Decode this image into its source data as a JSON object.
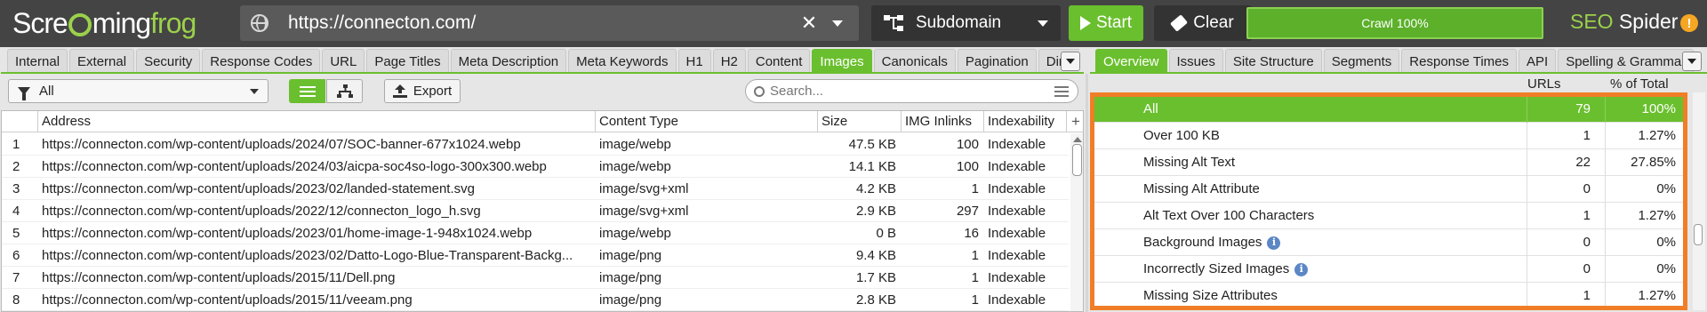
{
  "app": {
    "logo": {
      "part1": "Scre",
      "part2": "ming",
      "part3": "frog"
    },
    "url": "https://connecton.com/",
    "mode": "Subdomain",
    "start_label": "Start",
    "clear_label": "Clear",
    "progress_label": "Crawl 100%",
    "progress_fraction": 1.0,
    "brand_seo": "SEO",
    "brand_spider": "Spider",
    "update_badge": "!"
  },
  "left_tabs": [
    {
      "label": "Internal",
      "active": false
    },
    {
      "label": "External",
      "active": false
    },
    {
      "label": "Security",
      "active": false
    },
    {
      "label": "Response Codes",
      "active": false
    },
    {
      "label": "URL",
      "active": false
    },
    {
      "label": "Page Titles",
      "active": false
    },
    {
      "label": "Meta Description",
      "active": false
    },
    {
      "label": "Meta Keywords",
      "active": false
    },
    {
      "label": "H1",
      "active": false
    },
    {
      "label": "H2",
      "active": false
    },
    {
      "label": "Content",
      "active": false
    },
    {
      "label": "Images",
      "active": true
    },
    {
      "label": "Canonicals",
      "active": false
    },
    {
      "label": "Pagination",
      "active": false
    },
    {
      "label": "Directive",
      "active": false
    }
  ],
  "right_tabs": [
    {
      "label": "Overview",
      "active": true
    },
    {
      "label": "Issues",
      "active": false
    },
    {
      "label": "Site Structure",
      "active": false
    },
    {
      "label": "Segments",
      "active": false
    },
    {
      "label": "Response Times",
      "active": false
    },
    {
      "label": "API",
      "active": false
    },
    {
      "label": "Spelling & Grammar",
      "active": false
    }
  ],
  "toolbar": {
    "filter_value": "All",
    "export_label": "Export",
    "search_placeholder": "Search..."
  },
  "table": {
    "columns": [
      "Address",
      "Content Type",
      "Size",
      "IMG Inlinks",
      "Indexability"
    ],
    "rows": [
      {
        "n": "1",
        "address": "https://connecton.com/wp-content/uploads/2024/07/SOC-banner-677x1024.webp",
        "type": "image/webp",
        "size": "47.5 KB",
        "inlinks": "100",
        "index": "Indexable"
      },
      {
        "n": "2",
        "address": "https://connecton.com/wp-content/uploads/2024/03/aicpa-soc4so-logo-300x300.webp",
        "type": "image/webp",
        "size": "14.1 KB",
        "inlinks": "100",
        "index": "Indexable"
      },
      {
        "n": "3",
        "address": "https://connecton.com/wp-content/uploads/2023/02/landed-statement.svg",
        "type": "image/svg+xml",
        "size": "4.2 KB",
        "inlinks": "1",
        "index": "Indexable"
      },
      {
        "n": "4",
        "address": "https://connecton.com/wp-content/uploads/2022/12/connecton_logo_h.svg",
        "type": "image/svg+xml",
        "size": "2.9 KB",
        "inlinks": "297",
        "index": "Indexable"
      },
      {
        "n": "5",
        "address": "https://connecton.com/wp-content/uploads/2023/01/home-image-1-948x1024.webp",
        "type": "image/webp",
        "size": "0 B",
        "inlinks": "16",
        "index": "Indexable"
      },
      {
        "n": "6",
        "address": "https://connecton.com/wp-content/uploads/2023/02/Datto-Logo-Blue-Transparent-Backg...",
        "type": "image/png",
        "size": "9.4 KB",
        "inlinks": "1",
        "index": "Indexable"
      },
      {
        "n": "7",
        "address": "https://connecton.com/wp-content/uploads/2015/11/Dell.png",
        "type": "image/png",
        "size": "1.7 KB",
        "inlinks": "1",
        "index": "Indexable"
      },
      {
        "n": "8",
        "address": "https://connecton.com/wp-content/uploads/2015/11/veeam.png",
        "type": "image/png",
        "size": "2.8 KB",
        "inlinks": "1",
        "index": "Indexable"
      }
    ]
  },
  "overview": {
    "col_urls": "URLs",
    "col_pct": "% of Total",
    "rows": [
      {
        "label": "All",
        "urls": "79",
        "pct": "100%",
        "active": true,
        "info": false
      },
      {
        "label": "Over 100 KB",
        "urls": "1",
        "pct": "1.27%",
        "active": false,
        "info": false
      },
      {
        "label": "Missing Alt Text",
        "urls": "22",
        "pct": "27.85%",
        "active": false,
        "info": false
      },
      {
        "label": "Missing Alt Attribute",
        "urls": "0",
        "pct": "0%",
        "active": false,
        "info": false
      },
      {
        "label": "Alt Text Over 100 Characters",
        "urls": "1",
        "pct": "1.27%",
        "active": false,
        "info": false
      },
      {
        "label": "Background Images",
        "urls": "0",
        "pct": "0%",
        "active": false,
        "info": true
      },
      {
        "label": "Incorrectly Sized Images",
        "urls": "0",
        "pct": "0%",
        "active": false,
        "info": true
      },
      {
        "label": "Missing Size Attributes",
        "urls": "1",
        "pct": "1.27%",
        "active": false,
        "info": false
      }
    ]
  },
  "colors": {
    "accent": "#6abf2e",
    "highlight": "#f07e26",
    "topbar": "#444444"
  }
}
